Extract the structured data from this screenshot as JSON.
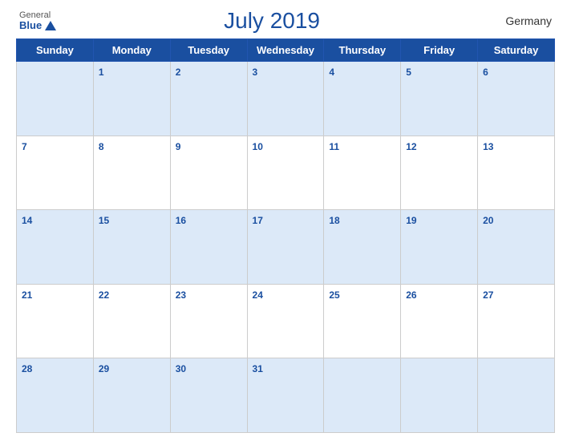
{
  "header": {
    "logo_general": "General",
    "logo_blue": "Blue",
    "title": "July 2019",
    "country": "Germany"
  },
  "weekdays": [
    "Sunday",
    "Monday",
    "Tuesday",
    "Wednesday",
    "Thursday",
    "Friday",
    "Saturday"
  ],
  "weeks": [
    [
      null,
      1,
      2,
      3,
      4,
      5,
      6
    ],
    [
      7,
      8,
      9,
      10,
      11,
      12,
      13
    ],
    [
      14,
      15,
      16,
      17,
      18,
      19,
      20
    ],
    [
      21,
      22,
      23,
      24,
      25,
      26,
      27
    ],
    [
      28,
      29,
      30,
      31,
      null,
      null,
      null
    ]
  ]
}
